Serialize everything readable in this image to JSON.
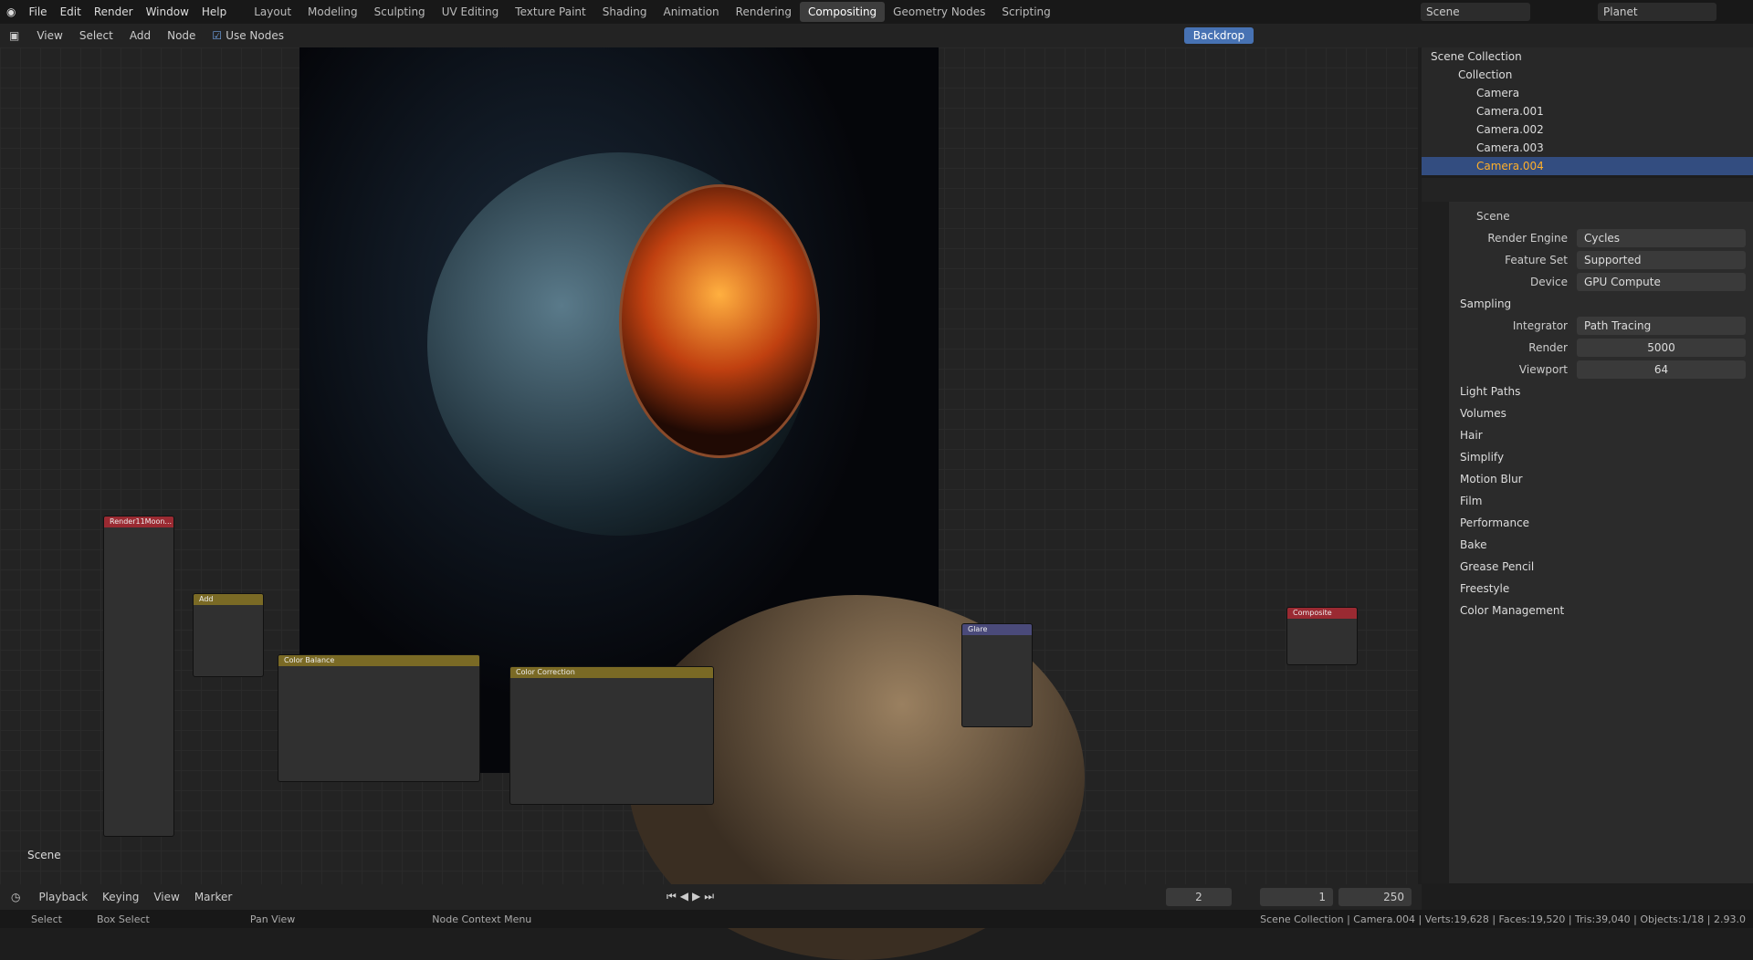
{
  "menu": [
    "File",
    "Edit",
    "Render",
    "Window",
    "Help"
  ],
  "workspaces": [
    "Layout",
    "Modeling",
    "Sculpting",
    "UV Editing",
    "Texture Paint",
    "Shading",
    "Animation",
    "Rendering",
    "Compositing",
    "Geometry Nodes",
    "Scripting"
  ],
  "active_workspace": "Compositing",
  "scene_name": "Scene",
  "view_layer": "Planet",
  "header": {
    "menus": [
      "View",
      "Select",
      "Add",
      "Node"
    ],
    "use_nodes": "Use Nodes",
    "backdrop": "Backdrop"
  },
  "canvas_label": "Scene",
  "outliner": {
    "root": "Scene Collection",
    "collection": "Collection",
    "items": [
      "Camera",
      "Camera.001",
      "Camera.002",
      "Camera.003",
      "Camera.004"
    ]
  },
  "properties": {
    "title": "Scene",
    "rows": [
      [
        "Render Engine",
        "Cycles"
      ],
      [
        "Feature Set",
        "Supported"
      ],
      [
        "Device",
        "GPU Compute"
      ]
    ],
    "sampling": "Sampling",
    "integrator": [
      "Integrator",
      "Path Tracing"
    ],
    "render": [
      "Render",
      "5000"
    ],
    "viewport": [
      "Viewport",
      "64"
    ],
    "sections": [
      "Light Paths",
      "Volumes",
      "Hair",
      "Simplify",
      "Motion Blur",
      "Film",
      "Performance",
      "Bake",
      "Grease Pencil",
      "Freestyle",
      "Color Management"
    ]
  },
  "nodes": [
    {
      "title": "Render11Moon..."
    },
    {
      "title": "Add"
    },
    {
      "title": "Color Balance"
    },
    {
      "title": "Color Correction"
    },
    {
      "title": "Glare"
    },
    {
      "title": "Composite"
    }
  ],
  "timeline": {
    "menus": [
      "Playback",
      "Keying",
      "View",
      "Marker"
    ],
    "frame": "2",
    "start": "1",
    "end": "250"
  },
  "status": {
    "select": "Select",
    "box": "Box Select",
    "pan": "Pan View",
    "ctx": "Node Context Menu",
    "info": "Scene Collection | Camera.004 | Verts:19,628 | Faces:19,520 | Tris:39,040 | Objects:1/18 | 2.93.0"
  }
}
